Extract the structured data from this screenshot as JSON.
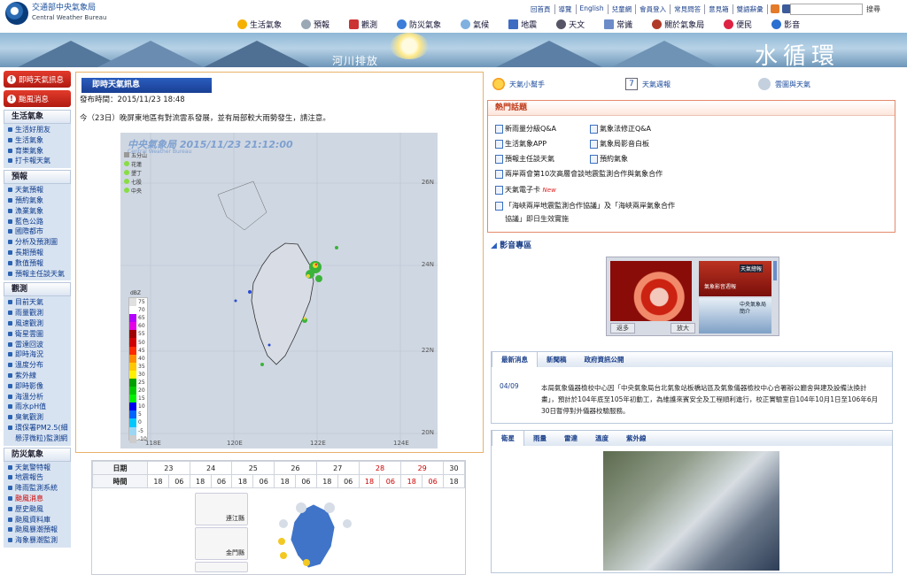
{
  "header": {
    "logo_cn": "交通部中央氣象局",
    "logo_en": "Central Weather Bureau",
    "top_links": [
      "回首頁",
      "導覽",
      "English",
      "兒童網",
      "會員登入",
      "常見問答",
      "意見箱",
      "雙語辭彙"
    ],
    "search_btn": "搜尋",
    "nav": [
      "生活氣象",
      "預報",
      "觀測",
      "防災氣象",
      "氣候",
      "地震",
      "天文",
      "常識",
      "關於氣象局",
      "便民",
      "影音"
    ]
  },
  "banner": {
    "left_text": "河川排放",
    "right_text": "水循環"
  },
  "sidebar": {
    "alerts": [
      "即時天氣訊息",
      "颱風消息"
    ],
    "sections": [
      {
        "title": "生活氣象",
        "items": [
          "生活好朋友",
          "生活氣象",
          "育樂氣象",
          "打卡報天氣"
        ]
      },
      {
        "title": "預報",
        "items": [
          "天氣預報",
          "預約氣象",
          "漁業氣象",
          "藍色公路",
          "國際都市",
          "分析及預測圖",
          "長期預報",
          "數值預報",
          "預報主任談天氣"
        ]
      },
      {
        "title": "觀測",
        "items": [
          "目前天氣",
          "雨量觀測",
          "風速觀測",
          "衛星雲圖",
          "雷達回波",
          "即時海況",
          "溫度分布",
          "紫外線",
          "即時影像",
          "海溫分析",
          "雨水pH值",
          "臭氧觀測",
          "環保署PM2.5(細懸浮微粒)監測網"
        ]
      },
      {
        "title": "防災氣象",
        "items": [
          "天氣警特報",
          "地震報告",
          "降雨監測系統",
          "颱風消息",
          "歷史颱風",
          "颱風資料庫",
          "颱風暴潮預報",
          "海象暴潮監測"
        ]
      }
    ],
    "current_item": "颱風消息"
  },
  "panel": {
    "title": "即時天氣訊息",
    "time": "發布時間：2015/11/23 18:48",
    "message": "今（23日）晚屏東地區有對流雲系發展，並有局部較大雨勢發生，請注意。"
  },
  "radar": {
    "title": "中央氣象局 2015/11/23 21:12:00",
    "title_en": "Central Weather Bureau",
    "legend": [
      "五分山",
      "花蓮",
      "墾丁",
      "七股",
      "中央"
    ],
    "unit": "dBZ",
    "scale": [
      "75",
      "70",
      "65",
      "60",
      "55",
      "50",
      "45",
      "40",
      "35",
      "30",
      "25",
      "20",
      "15",
      "10",
      "5",
      "0",
      "-5",
      "-10"
    ],
    "lats": [
      "26N",
      "24N",
      "22N",
      "20N"
    ],
    "lons": [
      "118E",
      "120E",
      "122E",
      "124E"
    ]
  },
  "forecast": {
    "date_label": "日期",
    "dates": [
      "23",
      "24",
      "25",
      "26",
      "27",
      "28",
      "29",
      "30"
    ],
    "time_label": "時間",
    "times": [
      "18",
      "06",
      "18",
      "06",
      "18",
      "06",
      "18",
      "06",
      "18",
      "06",
      "18",
      "06",
      "18",
      "06",
      "18"
    ],
    "places": [
      "連江縣",
      "金門縣"
    ]
  },
  "right": {
    "quick": [
      "天氣小幫手",
      "天氣週報",
      "雲圖與天氣"
    ],
    "quick_num": "7",
    "hot_title": "熱門話題",
    "hot_items": [
      "新雨量分級Q&A",
      "氣象法修正Q&A",
      "生活氣象APP",
      "氣象局影音白板",
      "預報主任談天氣",
      "預約氣象",
      "兩岸兩會第10次高層會談地震監測合作與氣象合作",
      "天氣電子卡",
      "「海峽兩岸地震監測合作協議」及「海峽兩岸氣象合作",
      "協議」即日生效實施"
    ],
    "hot_new": "New",
    "media_title": "影音專區",
    "media_btns": [
      "返多",
      "放大"
    ],
    "media_thumbs": [
      "天氣總報",
      "氣象影音週報",
      "中央氣象局簡介"
    ],
    "news_tabs": [
      "最新消息",
      "新聞稿",
      "政府資訊公開"
    ],
    "news_date": "04/09",
    "news_text": "本局氣象儀器檢校中心因「中央氣象局台北氣象站板橋站區及氣象儀器檢校中心合署辦公廳舍與建及設備汰換計畫」，預計於104年底至105年初動工，為維護來賓安全及工程順利進行，校正實驗室自104年10月1日至106年6月30日暫停對外儀器校驗服務。",
    "sat_tabs": [
      "衛星",
      "雨量",
      "雷達",
      "溫度",
      "紫外線"
    ]
  }
}
